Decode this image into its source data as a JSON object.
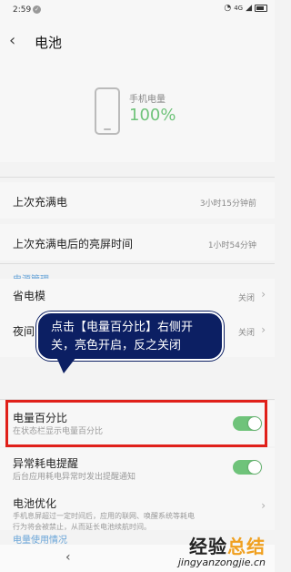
{
  "status_bar": {
    "time": "2:59",
    "signal_text": "4G"
  },
  "header": {
    "back_icon": "back-chevron-icon",
    "title": "电池"
  },
  "phone": {
    "label": "手机电量",
    "percent": "100%"
  },
  "rows": {
    "last_full": {
      "label": "上次充满电",
      "value": "3小时15分钟前"
    },
    "screen_on": {
      "label": "上次充满电后的亮屏时间",
      "value": "1小时54分钟"
    }
  },
  "section_power": "电源管理",
  "power_save": {
    "label": "省电模",
    "value": "关闭"
  },
  "night": {
    "label": "夜间",
    "value": "关闭"
  },
  "battery_percent": {
    "label": "电量百分比",
    "sub": "在状态栏显示电量百分比",
    "enabled": true
  },
  "abnormal": {
    "label": "异常耗电提醒",
    "sub": "后台应用耗电异常时发出提醒通知",
    "enabled": true
  },
  "optimize": {
    "label": "电池优化",
    "sub_line1": "手机息屏超过一定时间后，应用的联网、唤醒系统等耗电",
    "sub_line2": "行为将会被禁止，从而延长电池续航时间。"
  },
  "section_usage": "电量使用情况",
  "callout": {
    "text": "点击【电量百分比】右侧开关，亮色开启，反之关闭"
  },
  "watermark": {
    "main_a": "经验",
    "main_b": "总结",
    "sub": "jingyanzongjie.cn"
  },
  "colors": {
    "accent_green": "#6fc37a",
    "section_blue": "#6aa5d8",
    "highlight_red": "#e0201a",
    "callout_bg": "#0c1f63"
  }
}
